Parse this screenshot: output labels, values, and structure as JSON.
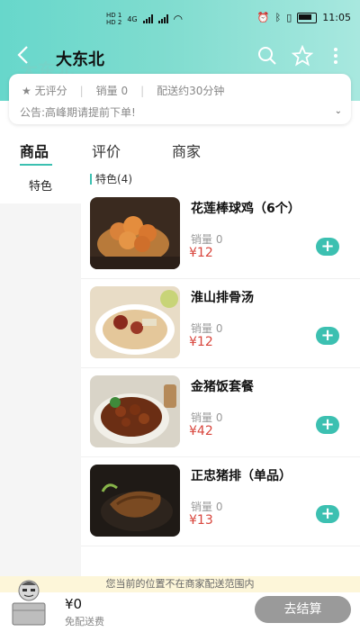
{
  "status_bar": {
    "sim1": "HD 1",
    "sim2": "HD 2",
    "network": "4G",
    "time": "11:05"
  },
  "header": {
    "title": "大东北",
    "ghost_title": "大东北",
    "bg_start": "#67d7cb",
    "bg_end": "#a8e8df"
  },
  "shop_info": {
    "rating": "无评分",
    "sales": "销量 0",
    "delivery": "配送约30分钟",
    "notice": "公告:高峰期请提前下单!"
  },
  "tabs": [
    {
      "label": "商品",
      "active": true
    },
    {
      "label": "评价",
      "active": false
    },
    {
      "label": "商家",
      "active": false
    }
  ],
  "categories": [
    {
      "label": "特色",
      "active": true
    }
  ],
  "section": {
    "label": "特色(4)"
  },
  "products": [
    {
      "name": "花莲棒球鸡（6个）",
      "sales": "销量 0",
      "price": "¥12",
      "image": "fried-chicken-balls"
    },
    {
      "name": "淮山排骨汤",
      "sales": "销量 0",
      "price": "¥12",
      "image": "yam-rib-soup"
    },
    {
      "name": "金猪饭套餐",
      "sales": "销量 0",
      "price": "¥42",
      "image": "pork-rice-bowl"
    },
    {
      "name": "正忠猪排（单品）",
      "sales": "销量 0",
      "price": "¥13",
      "image": "pork-chop"
    }
  ],
  "bottom": {
    "warning": "您当前的位置不在商家配送范围内",
    "total": "¥0",
    "free_shipping": "免配送费",
    "checkout": "去结算"
  },
  "colors": {
    "accent": "#3cc0b1",
    "price": "#d8453c",
    "checkout_disabled": "#9a9a9a",
    "warning_bg": "#fdf6d9"
  }
}
